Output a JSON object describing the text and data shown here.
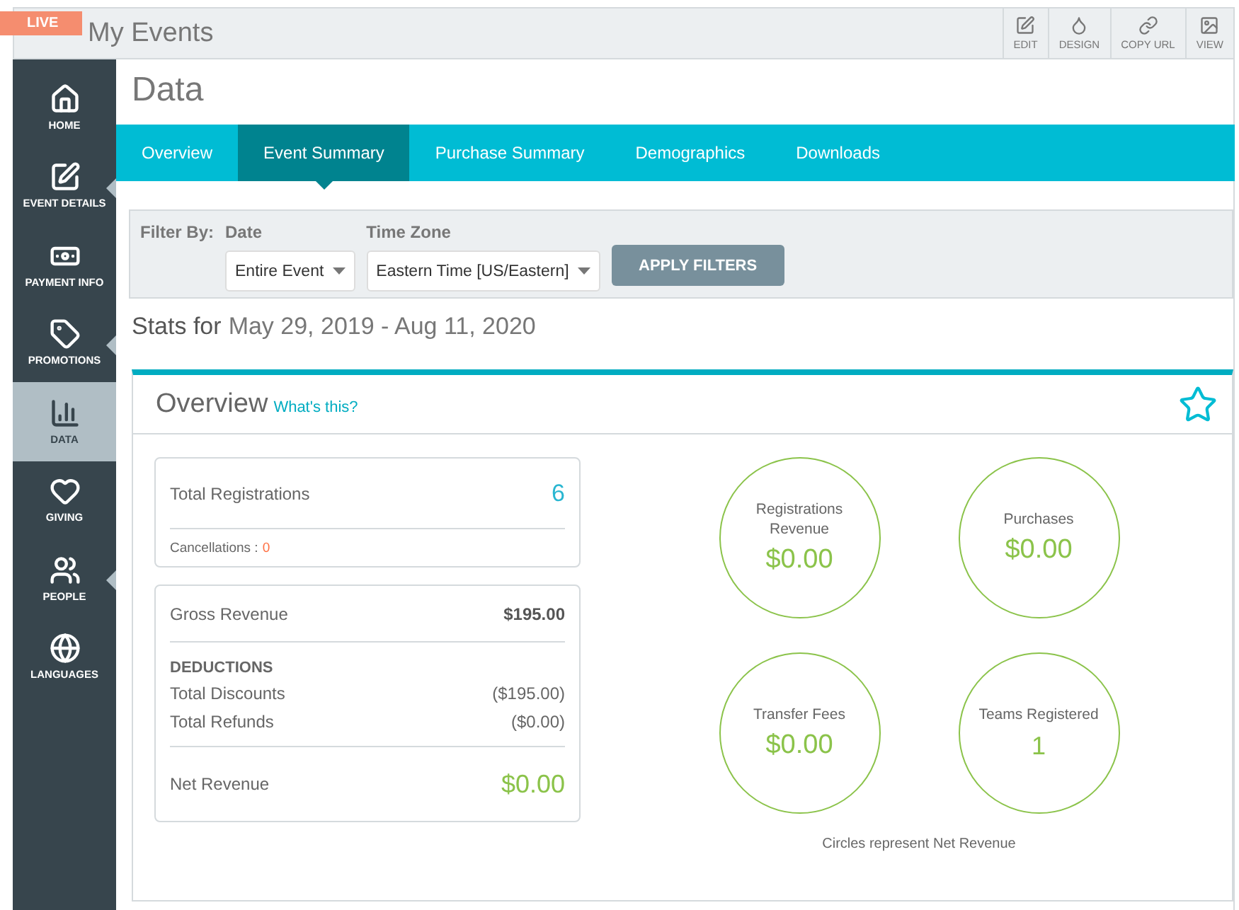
{
  "live_badge": "LIVE",
  "app_title": "My Events",
  "toolbar": [
    {
      "label": "EDIT",
      "kind": "edit"
    },
    {
      "label": "DESIGN",
      "kind": "drop"
    },
    {
      "label": "COPY URL",
      "kind": "link"
    },
    {
      "label": "VIEW",
      "kind": "image"
    }
  ],
  "sidebar": {
    "items": [
      {
        "label": "HOME",
        "kind": "home",
        "selected": false,
        "has_submenu": false
      },
      {
        "label": "EVENT DETAILS",
        "kind": "edit",
        "selected": false,
        "has_submenu": true
      },
      {
        "label": "PAYMENT INFO",
        "kind": "money",
        "selected": false,
        "has_submenu": false
      },
      {
        "label": "PROMOTIONS",
        "kind": "tag",
        "selected": false,
        "has_submenu": true
      },
      {
        "label": "DATA",
        "kind": "chart",
        "selected": true,
        "has_submenu": false
      },
      {
        "label": "GIVING",
        "kind": "heart",
        "selected": false,
        "has_submenu": false
      },
      {
        "label": "PEOPLE",
        "kind": "people",
        "selected": false,
        "has_submenu": true
      },
      {
        "label": "LANGUAGES",
        "kind": "globe",
        "selected": false,
        "has_submenu": false
      }
    ]
  },
  "page_title": "Data",
  "tabs": [
    {
      "label": "Overview",
      "selected": false
    },
    {
      "label": "Event Summary",
      "selected": true
    },
    {
      "label": "Purchase Summary",
      "selected": false
    },
    {
      "label": "Demographics",
      "selected": false
    },
    {
      "label": "Downloads",
      "selected": false
    }
  ],
  "filters": {
    "label": "Filter By:",
    "fields": [
      {
        "label": "Date",
        "value": "Entire Event"
      },
      {
        "label": "Time Zone",
        "value": "Eastern Time [US/Eastern]"
      }
    ],
    "button": "APPLY FILTERS"
  },
  "stats": {
    "prefix": "Stats for",
    "range": "May 29, 2019 - Aug 11, 2020"
  },
  "overview": {
    "title": "Overview",
    "help_link": "What's this?",
    "registrations": {
      "label": "Total Registrations",
      "value": "6",
      "cancellations_label": "Cancellations :",
      "cancellations_value": "0"
    },
    "revenue": {
      "gross_label": "Gross Revenue",
      "gross_value": "$195.00",
      "deductions_heading": "DEDUCTIONS",
      "deductions": [
        {
          "label": "Total Discounts",
          "value": "($195.00)"
        },
        {
          "label": "Total Refunds",
          "value": "($0.00)"
        }
      ],
      "net_label": "Net Revenue",
      "net_value": "$0.00"
    },
    "circles": [
      {
        "label": "Registrations Revenue",
        "value": "$0.00",
        "kind": "money"
      },
      {
        "label": "Purchases",
        "value": "$0.00",
        "kind": "money"
      },
      {
        "label": "Transfer Fees",
        "value": "$0.00",
        "kind": "money"
      },
      {
        "label": "Teams Registered",
        "value": "1",
        "kind": "count"
      }
    ],
    "footnote": "Circles represent Net Revenue"
  }
}
